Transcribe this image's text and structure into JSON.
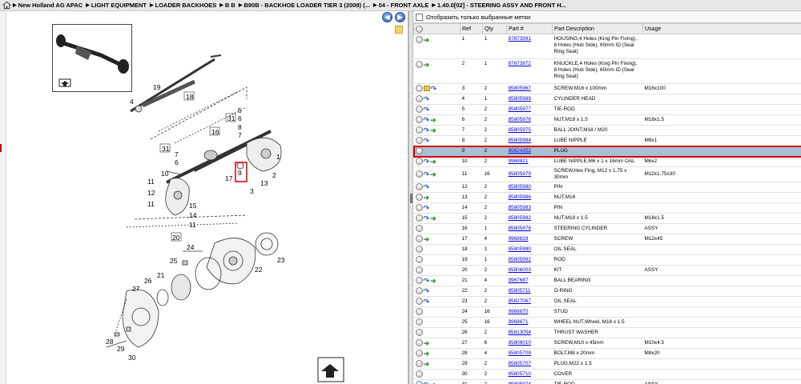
{
  "breadcrumb": {
    "items": [
      "New Holland AG APAC",
      "LIGHT EQUIPMENT",
      "LOADER BACKHOES",
      "B B",
      "B90B - BACKHOE LOADER TIER 3 (2008) (...",
      "04 - FRONT AXLE",
      "1.40.0[02] - STEERING ASSY AND FRONT H..."
    ]
  },
  "toolbar": {
    "back_glyph": "◀",
    "forward_glyph": "▶"
  },
  "filter": {
    "label": "Отобразить только выбранные метки"
  },
  "table": {
    "headers": {
      "ref": "Ref",
      "qty": "Qty",
      "part": "Part #",
      "desc": "Part Description",
      "usage": "Usage"
    },
    "rows": [
      {
        "ref": "1",
        "qty": "1",
        "part": "87673991",
        "desc": "HOUSING,4 Holes (King Pin Fixing), 8 Holes (Hub Side), 60mm ID (Seal Ring Seat)",
        "usage": ""
      },
      {
        "ref": "2",
        "qty": "1",
        "part": "87673972",
        "desc": "KNUCKLE,4 Holes (King Pin Fixing), 8 Holes (Hub Side), 60mm ID (Seal Ring Seat)",
        "usage": ""
      },
      {
        "ref": "3",
        "qty": "2",
        "part": "85805967",
        "desc": "SCREW,M16 x 100mm",
        "usage": "M16x100"
      },
      {
        "ref": "4",
        "qty": "1",
        "part": "85805989",
        "desc": "CYLINDER HEAD",
        "usage": ""
      },
      {
        "ref": "5",
        "qty": "2",
        "part": "85805977",
        "desc": "TIE-ROD",
        "usage": ""
      },
      {
        "ref": "6",
        "qty": "2",
        "part": "85805976",
        "desc": "NUT,M18 x 1.5",
        "usage": "M18x1.5"
      },
      {
        "ref": "7",
        "qty": "2",
        "part": "85805975",
        "desc": "BALL JOINT,M18 / M20",
        "usage": ""
      },
      {
        "ref": "8",
        "qty": "2",
        "part": "85805984",
        "desc": "LUBE NIPPLE",
        "usage": "M6x1"
      },
      {
        "ref": "9",
        "qty": "2",
        "part": "85824352",
        "desc": "PLUG",
        "usage": ""
      },
      {
        "ref": "10",
        "qty": "2",
        "part": "9968821",
        "desc": "LUBE NIPPLE,M6 x 1 x 16mm OAL",
        "usage": "M6x2"
      },
      {
        "ref": "11",
        "qty": "16",
        "part": "85805979",
        "desc": "SCREW,Hex Flng, M12 x 1.75 x 30mm",
        "usage": "M12x1.75x30"
      },
      {
        "ref": "12",
        "qty": "2",
        "part": "85805980",
        "desc": "PIN",
        "usage": ""
      },
      {
        "ref": "13",
        "qty": "2",
        "part": "85805986",
        "desc": "NUT,M16",
        "usage": ""
      },
      {
        "ref": "14",
        "qty": "2",
        "part": "85805983",
        "desc": "PIN",
        "usage": ""
      },
      {
        "ref": "15",
        "qty": "2",
        "part": "85805982",
        "desc": "NUT,M18 x 1.5",
        "usage": "M18x1.5"
      },
      {
        "ref": "16",
        "qty": "1",
        "part": "85805978",
        "desc": "STEERING CYLINDER",
        "usage": "ASSY"
      },
      {
        "ref": "17",
        "qty": "4",
        "part": "9968828",
        "desc": "SCREW",
        "usage": "M12x45"
      },
      {
        "ref": "18",
        "qty": "1",
        "part": "85805990",
        "desc": "OIL SEAL",
        "usage": ""
      },
      {
        "ref": "19",
        "qty": "1",
        "part": "85805992",
        "desc": "ROD",
        "usage": ""
      },
      {
        "ref": "20",
        "qty": "2",
        "part": "85806003",
        "desc": "KIT",
        "usage": "ASSY"
      },
      {
        "ref": "21",
        "qty": "4",
        "part": "9967687",
        "desc": "BALL BEARING",
        "usage": ""
      },
      {
        "ref": "22",
        "qty": "2",
        "part": "85805711",
        "desc": "O-RING",
        "usage": ""
      },
      {
        "ref": "23",
        "qty": "2",
        "part": "85827067",
        "desc": "OIL SEAL",
        "usage": ""
      },
      {
        "ref": "24",
        "qty": "16",
        "part": "9968870",
        "desc": "STUD",
        "usage": ""
      },
      {
        "ref": "25",
        "qty": "16",
        "part": "9968871",
        "desc": "WHEEL NUT,Wheel, M18 x 1.5",
        "usage": ""
      },
      {
        "ref": "26",
        "qty": "2",
        "part": "85813054",
        "desc": "THRUST WASHER",
        "usage": ""
      },
      {
        "ref": "27",
        "qty": "6",
        "part": "85806010",
        "desc": "SCREW,M10 x 45mm",
        "usage": "M10x4.5"
      },
      {
        "ref": "28",
        "qty": "4",
        "part": "85805709",
        "desc": "BOLT,M8 x 20mm",
        "usage": "M8x20"
      },
      {
        "ref": "29",
        "qty": "2",
        "part": "85805707",
        "desc": "PLUG,M22 x 1.5",
        "usage": ""
      },
      {
        "ref": "30",
        "qty": "2",
        "part": "85805710",
        "desc": "COVER",
        "usage": ""
      },
      {
        "ref": "31",
        "qty": "2",
        "part": "85805974",
        "desc": "TIE-ROD",
        "usage": "ASSY"
      }
    ]
  },
  "row_icons": [
    "circle,arrow-green",
    "circle,arrow-green",
    "circle,folder,arrow-blue",
    "circle,arrow-blue",
    "circle,arrow-blue",
    "circle,arrow-blue,arrow-green",
    "circle,arrow-blue,arrow-green",
    "circle,arrow-blue",
    "circle",
    "circle,arrow-blue,arrow-green",
    "circle,arrow-blue,arrow-green",
    "circle,arrow-blue",
    "circle,arrow-green",
    "circle,arrow-blue",
    "circle,arrow-blue,arrow-green",
    "circle",
    "circle,arrow-green",
    "circle",
    "circle",
    "circle",
    "circle,arrow-blue,arrow-green",
    "circle,arrow-blue",
    "circle,arrow-blue",
    "circle",
    "circle",
    "circle",
    "circle,arrow-green",
    "circle,arrow-green",
    "circle,arrow-green",
    "circle",
    "circle,arrow-blue,arrow-green"
  ],
  "selected_ref": "9",
  "diagram": {
    "callouts": [
      "19",
      "4",
      "18",
      "16",
      "5",
      "31",
      "6",
      "8",
      "7",
      "1",
      "9",
      "13",
      "3",
      "2",
      "31",
      "7",
      "6",
      "10",
      "17",
      "11",
      "12",
      "15",
      "14",
      "11",
      "11",
      "20",
      "24",
      "25",
      "23",
      "22",
      "21",
      "26",
      "27",
      "28",
      "29",
      "30"
    ]
  },
  "colors": {
    "selected_row": "#a9bfd3",
    "highlight_border": "#d40000",
    "link": "#0000cc"
  }
}
